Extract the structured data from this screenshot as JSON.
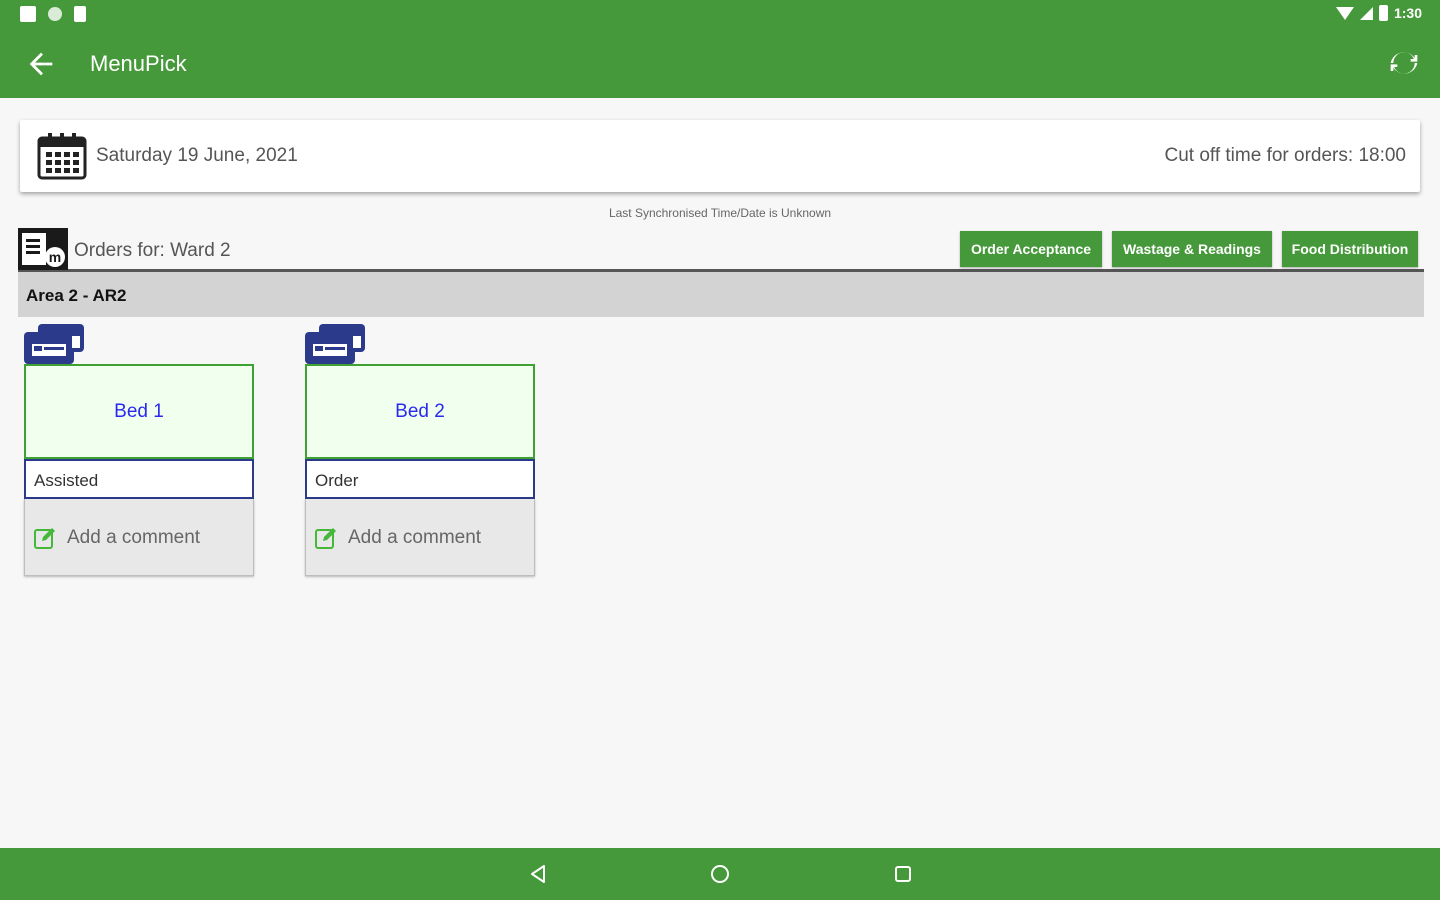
{
  "status_bar": {
    "time": "1:30"
  },
  "app_bar": {
    "title": "MenuPick"
  },
  "date_card": {
    "date": "Saturday 19 June, 2021",
    "cutoff": "Cut off time for orders: 18:00"
  },
  "sync_text": "Last Synchronised Time/Date is Unknown",
  "orders": {
    "label": "Orders for: Ward 2",
    "buttons": [
      "Order Acceptance",
      "Wastage & Readings",
      "Food Distribution"
    ]
  },
  "area": {
    "label": "Area 2 - AR2"
  },
  "beds": [
    {
      "name": "Bed 1",
      "status": "Assisted",
      "comment_label": "Add a comment"
    },
    {
      "name": "Bed 2",
      "status": "Order",
      "comment_label": "Add a comment"
    }
  ],
  "colors": {
    "primary_green": "#45993a",
    "bed_name_text": "#2a2aee",
    "bed_name_bg": "#f0ffee",
    "bed_status_border": "#2c3a8c",
    "area_header_bg": "#d3d3d3"
  }
}
